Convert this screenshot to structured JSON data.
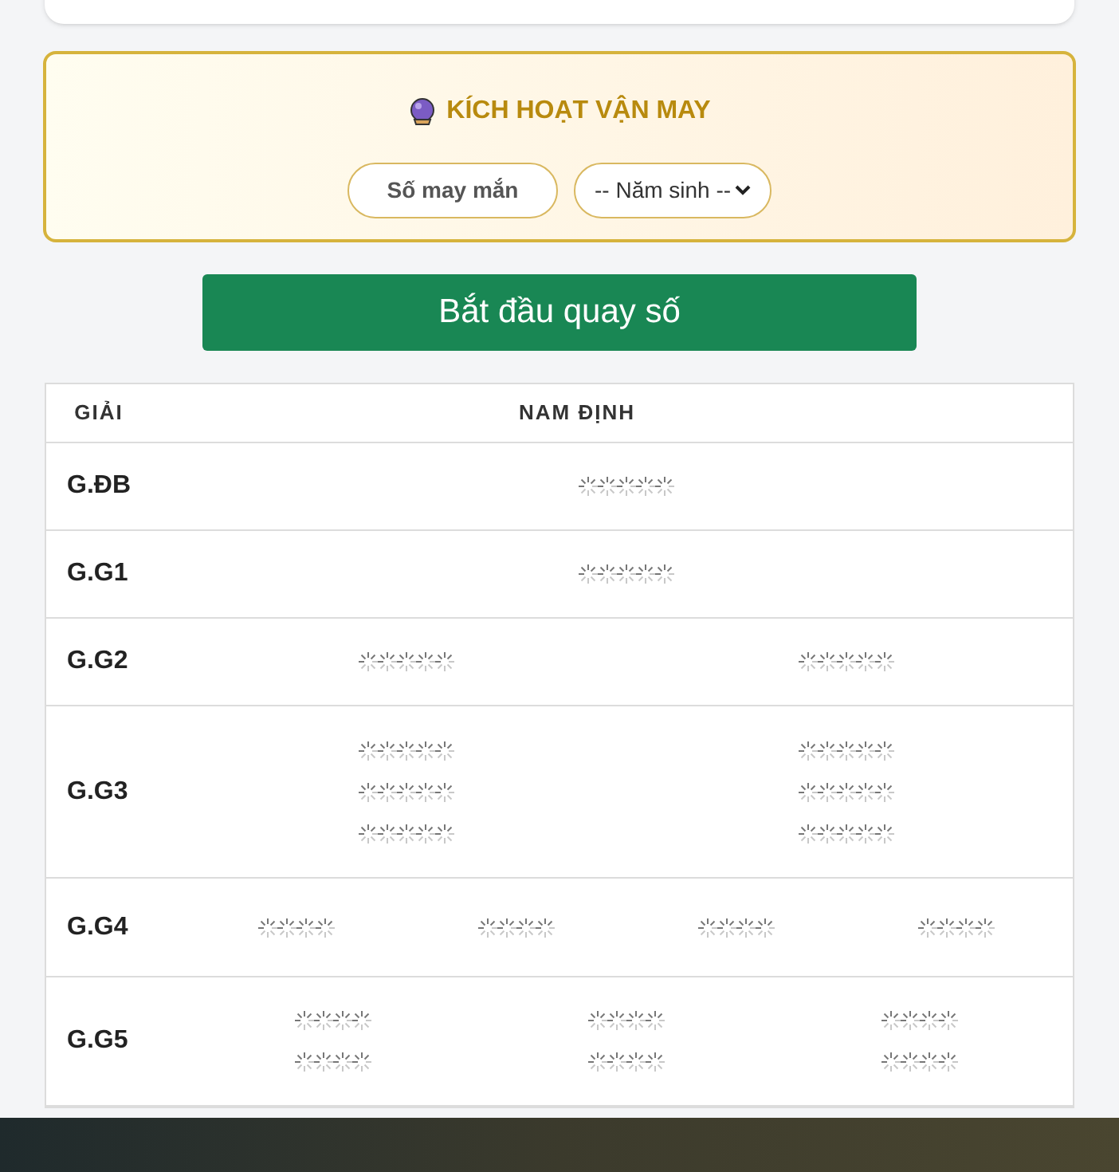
{
  "lucky": {
    "title": "KÍCH HOẠT VẬN MAY",
    "number_button": "Số may mắn",
    "year_select": {
      "value": "-- Năm sinh --"
    }
  },
  "start_button": "Bắt đầu quay số",
  "table": {
    "columns": [
      "GIẢI",
      "NAM ĐỊNH"
    ],
    "rows": [
      {
        "label": "G.ĐB",
        "cells": [
          [
            [
              true,
              true,
              true,
              true,
              true
            ]
          ]
        ]
      },
      {
        "label": "G.G1",
        "cells": [
          [
            [
              true,
              true,
              true,
              true,
              true
            ]
          ]
        ]
      },
      {
        "label": "G.G2",
        "cells": [
          [
            [
              true,
              true,
              true,
              true,
              true
            ]
          ],
          [
            [
              true,
              true,
              true,
              true,
              true
            ]
          ]
        ]
      },
      {
        "label": "G.G3",
        "cells": [
          [
            [
              true,
              true,
              true,
              true,
              true
            ],
            [
              true,
              true,
              true,
              true,
              true
            ],
            [
              true,
              true,
              true,
              true,
              true
            ]
          ],
          [
            [
              true,
              true,
              true,
              true,
              true
            ],
            [
              true,
              true,
              true,
              true,
              true
            ],
            [
              true,
              true,
              true,
              true,
              true
            ]
          ]
        ]
      },
      {
        "label": "G.G4",
        "cells": [
          [
            [
              true,
              true,
              true,
              true
            ]
          ],
          [
            [
              true,
              true,
              true,
              true
            ]
          ],
          [
            [
              true,
              true,
              true,
              true
            ]
          ],
          [
            [
              true,
              true,
              true,
              true
            ]
          ]
        ]
      },
      {
        "label": "G.G5",
        "cells": [
          [
            [
              true,
              true,
              true,
              true
            ],
            [
              true,
              true,
              true,
              true
            ]
          ],
          [
            [
              true,
              true,
              true,
              true
            ],
            [
              true,
              true,
              true,
              true
            ]
          ],
          [
            [
              true,
              true,
              true,
              true
            ],
            [
              true,
              true,
              true,
              true
            ]
          ]
        ]
      }
    ]
  }
}
